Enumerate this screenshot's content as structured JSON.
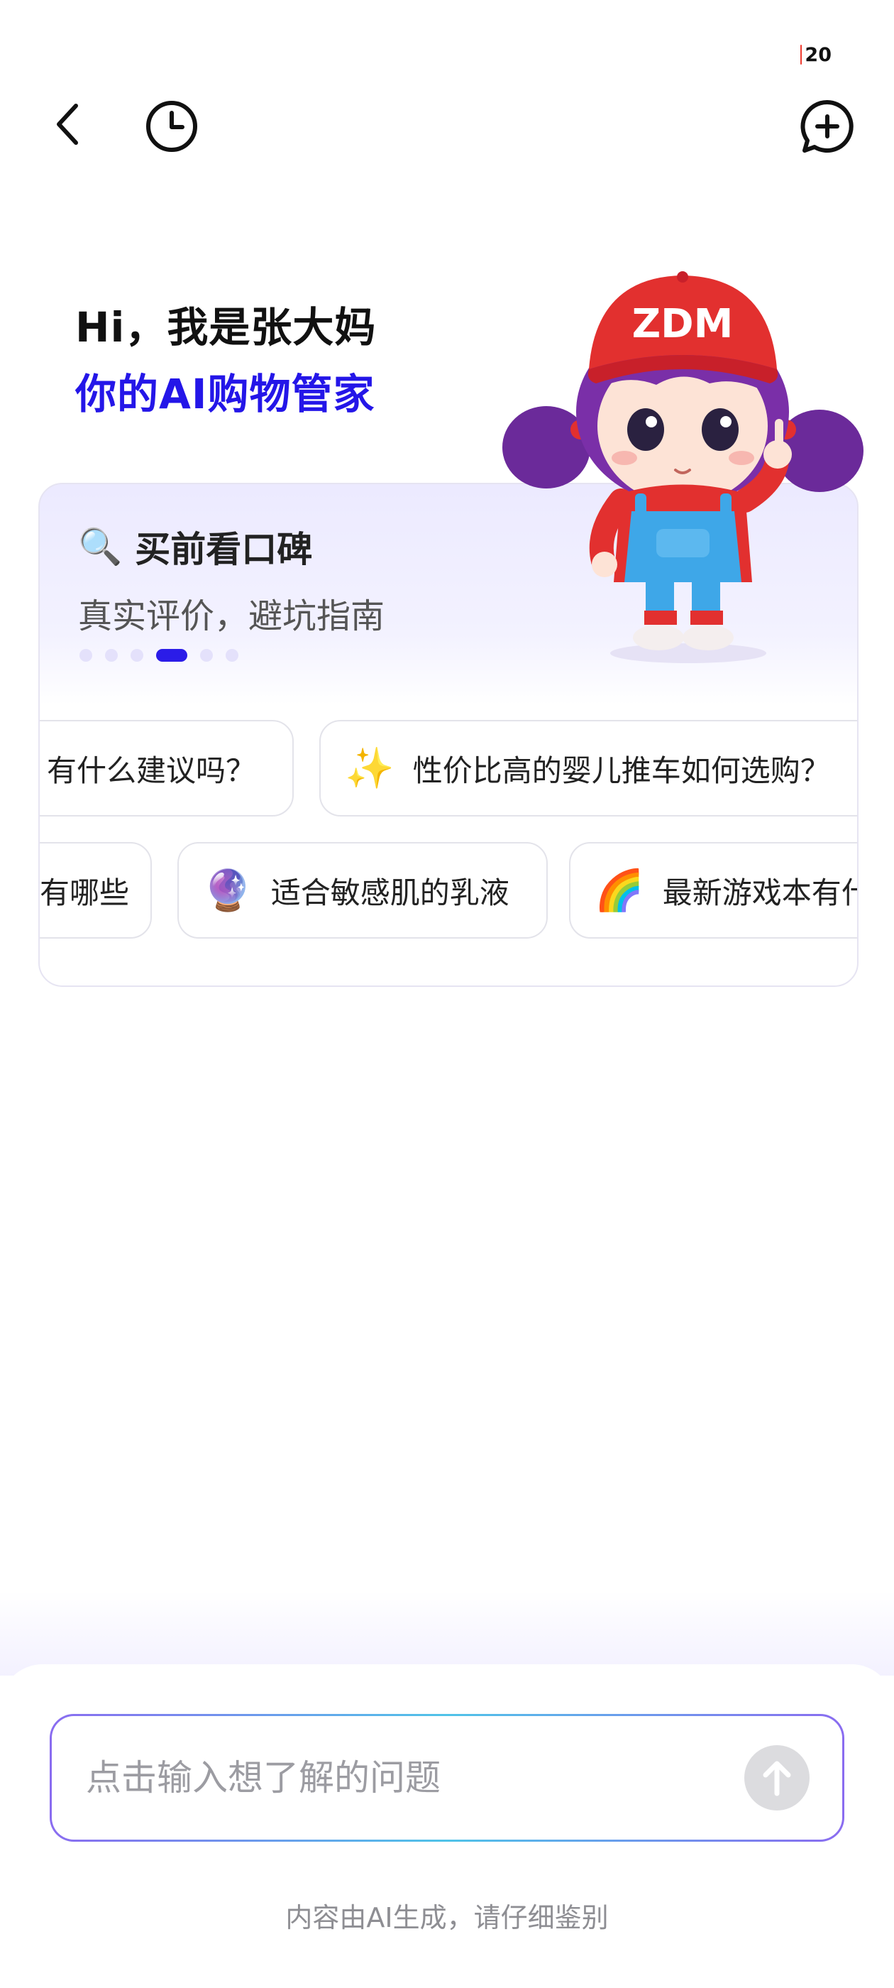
{
  "status": {
    "battery": "20",
    "battery_color": "#ee3b2f"
  },
  "header": {
    "back_icon": "chevron-left-icon",
    "history_icon": "clock-icon",
    "new_chat_icon": "chat-plus-icon"
  },
  "greeting": {
    "line1": "Hi，我是张大妈",
    "line2": "你的AI购物管家",
    "accent": "#2416e8"
  },
  "mascot": {
    "cap_text": "ZDM"
  },
  "feature": {
    "icon": "🔍",
    "title": "买前看口碑",
    "desc": "真实评价，避坑指南",
    "active_index": 3,
    "total": 6
  },
  "suggestions": {
    "row1": [
      {
        "emoji": "",
        "text": "有什么建议吗？"
      },
      {
        "emoji": "✨",
        "text": "性价比高的婴儿推车如何选购？"
      }
    ],
    "row2": [
      {
        "emoji": "",
        "text": "有哪些"
      },
      {
        "emoji": "🔮",
        "text": "适合敏感肌的乳液"
      },
      {
        "emoji": "🌈",
        "text": "最新游戏本有什么"
      }
    ]
  },
  "composer": {
    "placeholder": "点击输入想了解的问题",
    "send_icon": "arrow-up-icon"
  },
  "footer": {
    "disclaimer": "内容由AI生成，请仔细鉴别"
  }
}
